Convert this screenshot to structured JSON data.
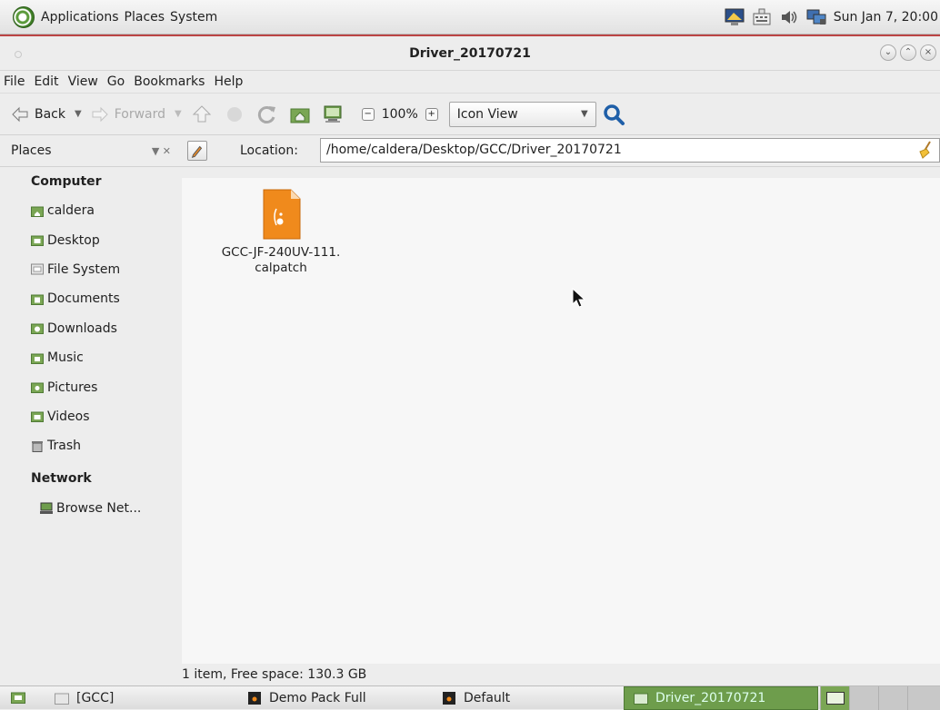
{
  "top_panel": {
    "menus": [
      "Applications",
      "Places",
      "System"
    ],
    "clock": "Sun Jan  7, 20:00"
  },
  "window": {
    "title": "Driver_20170721",
    "menubar": [
      "File",
      "Edit",
      "View",
      "Go",
      "Bookmarks",
      "Help"
    ],
    "toolbar": {
      "back": "Back",
      "forward": "Forward",
      "zoom": "100%",
      "view_mode": "Icon View"
    },
    "places_label": "Places",
    "location_label": "Location:",
    "location_value": "/home/caldera/Desktop/GCC/Driver_20170721",
    "sidebar": {
      "computer_heading": "Computer",
      "items": [
        "caldera",
        "Desktop",
        "File System",
        "Documents",
        "Downloads",
        "Music",
        "Pictures",
        "Videos",
        "Trash"
      ],
      "network_heading": "Network",
      "network_items": [
        "Browse Net..."
      ]
    },
    "files": [
      {
        "name_line1": "GCC-JF-240UV-111.",
        "name_line2": "calpatch"
      }
    ],
    "status": "1 item, Free space: 130.3 GB"
  },
  "bottom_panel": {
    "tasks": [
      "[GCC]",
      "Demo Pack Full",
      "Default",
      "Driver_20170721"
    ]
  },
  "colors": {
    "accent_green": "#6e9d4c",
    "file_orange": "#f08a1c",
    "search_blue": "#1f5fa8"
  }
}
